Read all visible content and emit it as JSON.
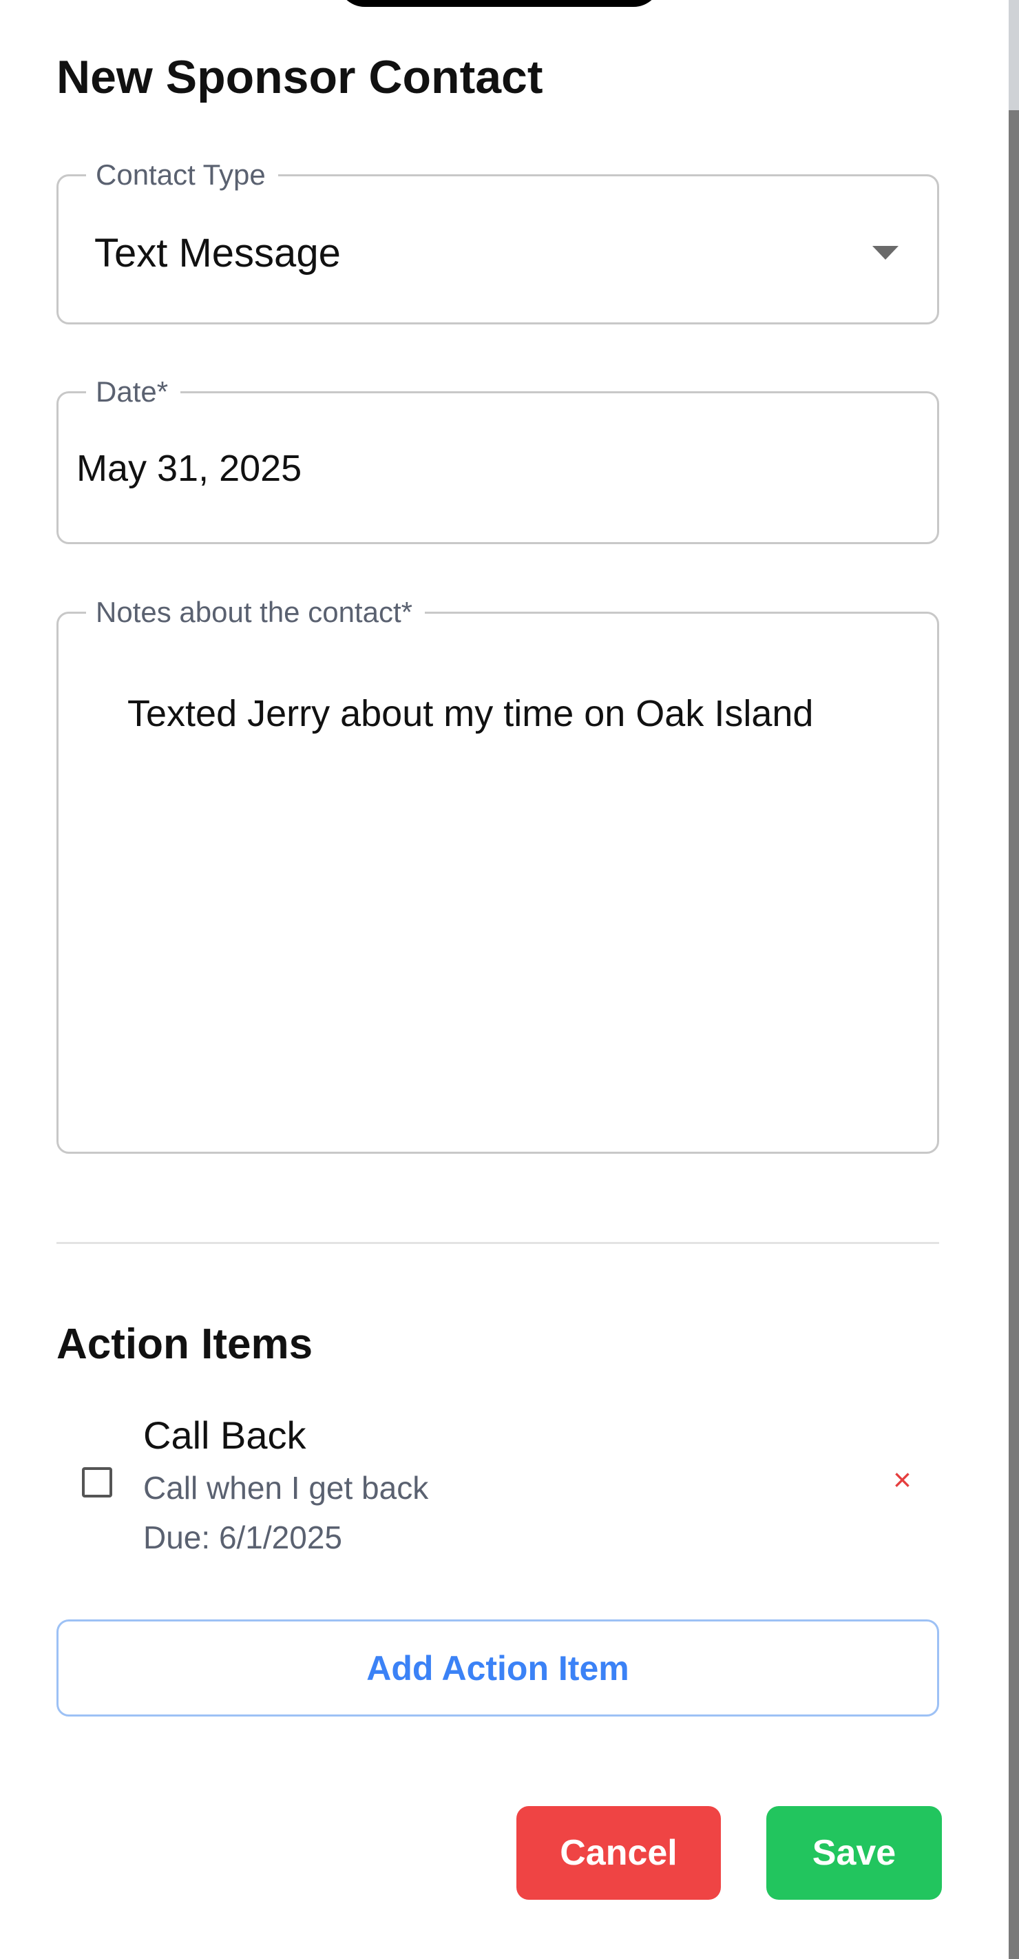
{
  "modal": {
    "title": "New Sponsor Contact"
  },
  "contact_type": {
    "label": "Contact Type",
    "value": "Text Message"
  },
  "date": {
    "label": "Date*",
    "value": "May 31, 2025"
  },
  "notes": {
    "label": "Notes about the contact*",
    "value": "Texted Jerry about my time on Oak Island"
  },
  "action_items": {
    "title": "Action Items",
    "items": [
      {
        "title": "Call Back",
        "description": "Call when I get back",
        "due": "Due: 6/1/2025",
        "checked": false,
        "remove_glyph": "×"
      }
    ],
    "add_label": "Add Action Item"
  },
  "buttons": {
    "cancel": "Cancel",
    "save": "Save"
  },
  "colors": {
    "cancel": "#ef4444",
    "save": "#22c55e",
    "add_action": "#3b82f6",
    "remove": "#e53e3e"
  },
  "icons": {
    "dropdown": "chevron-down-icon",
    "checkbox": "checkbox-unchecked-icon",
    "remove": "close-icon"
  }
}
